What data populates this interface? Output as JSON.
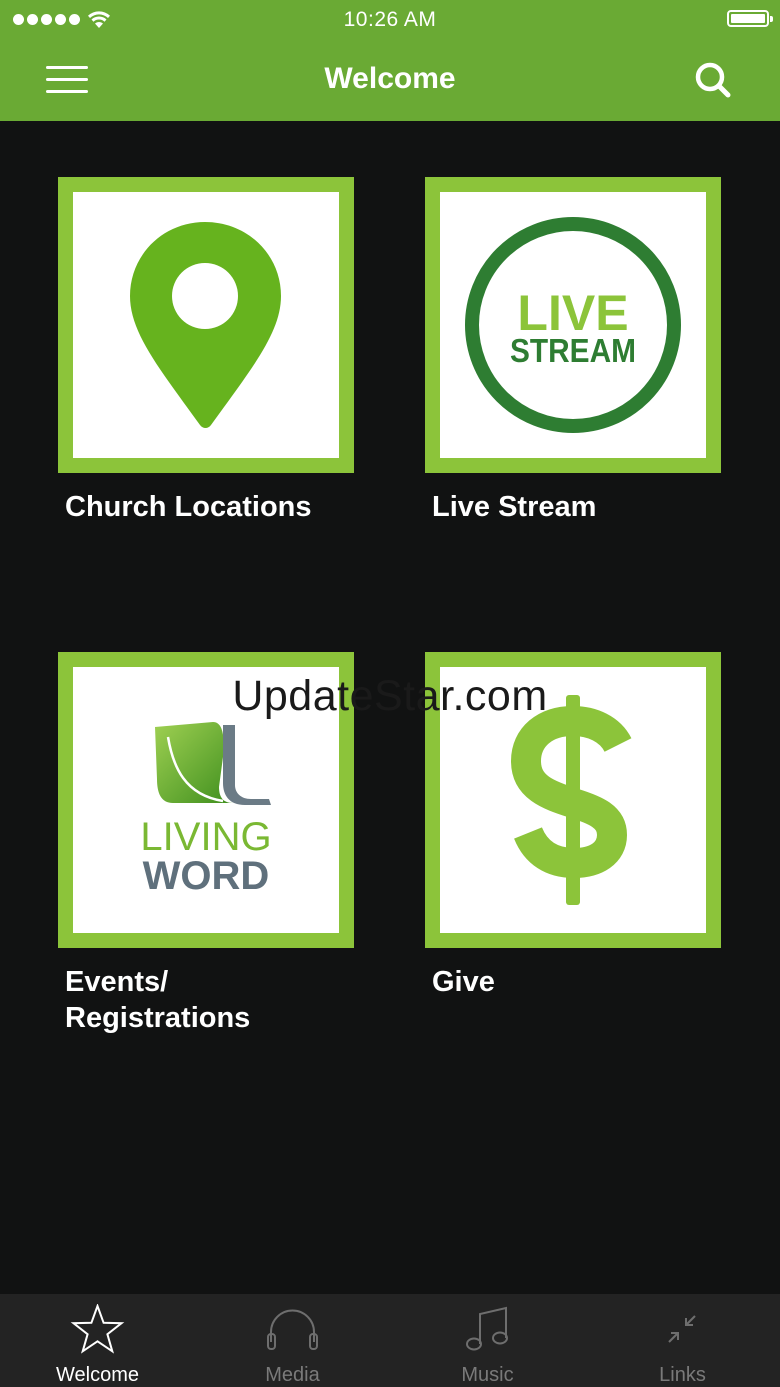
{
  "status_bar": {
    "time": "10:26 AM"
  },
  "header": {
    "title": "Welcome",
    "menu_icon": "hamburger-menu-icon",
    "search_icon": "search-icon"
  },
  "tiles": [
    {
      "label": "Church Locations",
      "icon": "map-pin-icon"
    },
    {
      "label": "Live Stream",
      "icon": "live-stream-logo",
      "logo_text_1": "LIVE",
      "logo_text_2": "STREAM"
    },
    {
      "label": "Events/\nRegistrations",
      "icon": "living-word-logo",
      "logo_text_1": "LIVING",
      "logo_text_2": "WORD"
    },
    {
      "label": "Give",
      "icon": "dollar-icon"
    }
  ],
  "watermark": "UpdateStar.com",
  "tabbar": {
    "active": "Welcome",
    "items": [
      {
        "label": "Welcome",
        "icon": "star-icon"
      },
      {
        "label": "Media",
        "icon": "headphones-icon"
      },
      {
        "label": "Music",
        "icon": "music-note-icon"
      },
      {
        "label": "Links",
        "icon": "collapse-arrows-icon"
      }
    ]
  },
  "colors": {
    "header_green": "#6aaa34",
    "tile_green": "#8cc43a",
    "background": "#111212",
    "live_stream_green": "#2e7d32"
  }
}
